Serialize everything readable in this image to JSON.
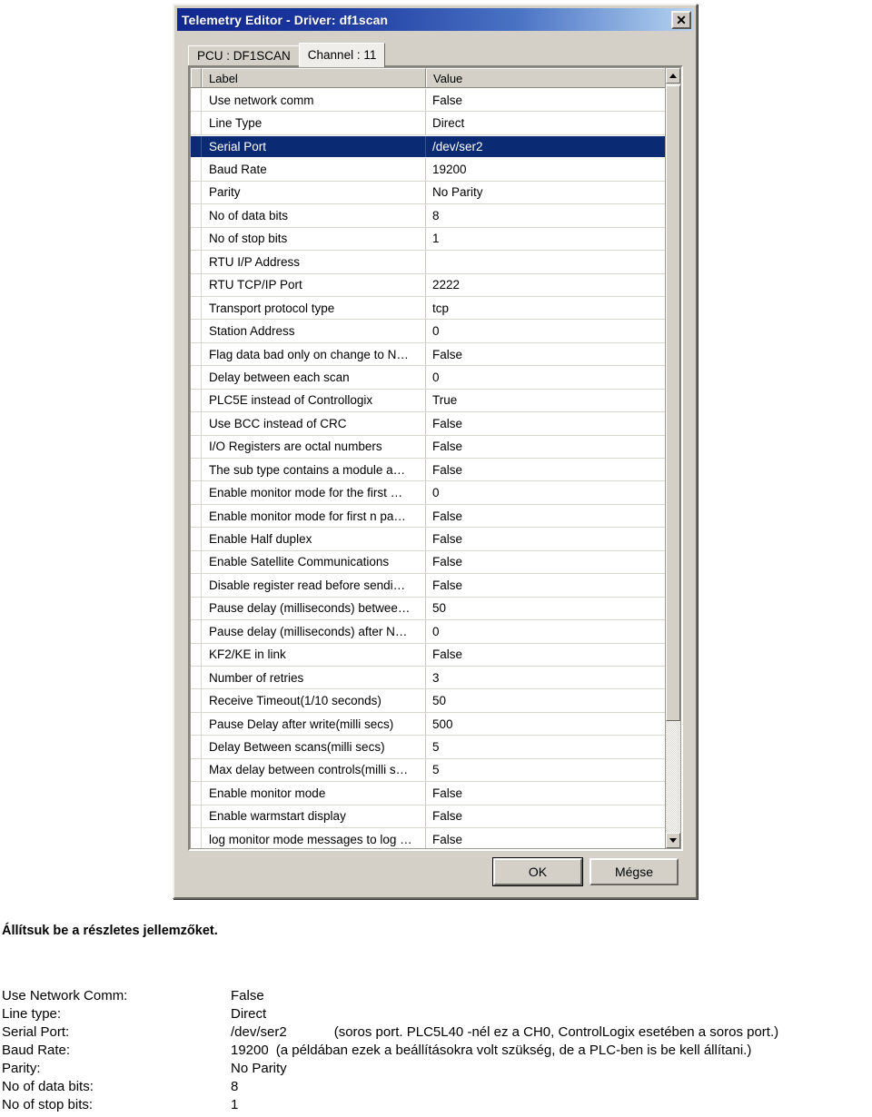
{
  "dialog": {
    "title": "Telemetry Editor - Driver: df1scan",
    "close_label": "✕",
    "tabs": [
      {
        "label": "PCU : DF1SCAN",
        "active": false
      },
      {
        "label": "Channel : 11",
        "active": true
      }
    ],
    "grid": {
      "columns": [
        "Label",
        "Value"
      ],
      "selected_index": 2,
      "rows": [
        {
          "label": "Use network comm",
          "value": "False"
        },
        {
          "label": "Line Type",
          "value": "Direct"
        },
        {
          "label": "Serial Port",
          "value": "/dev/ser2"
        },
        {
          "label": "Baud Rate",
          "value": "19200"
        },
        {
          "label": "Parity",
          "value": "No Parity"
        },
        {
          "label": "No of data bits",
          "value": "8"
        },
        {
          "label": "No of stop bits",
          "value": "1"
        },
        {
          "label": "RTU I/P Address",
          "value": ""
        },
        {
          "label": "RTU TCP/IP Port",
          "value": "2222"
        },
        {
          "label": "Transport protocol type",
          "value": "tcp"
        },
        {
          "label": "Station Address",
          "value": "0"
        },
        {
          "label": "Flag data bad only on change to N…",
          "value": "False"
        },
        {
          "label": "Delay between each scan",
          "value": "0"
        },
        {
          "label": "PLC5E instead of Controllogix",
          "value": "True"
        },
        {
          "label": "Use BCC instead of CRC",
          "value": "False"
        },
        {
          "label": "I/O Registers are octal numbers",
          "value": "False"
        },
        {
          "label": "The sub type contains a module a…",
          "value": "False"
        },
        {
          "label": "Enable monitor mode for the first …",
          "value": "0"
        },
        {
          "label": "Enable monitor mode for first n pa…",
          "value": "False"
        },
        {
          "label": "Enable Half duplex",
          "value": "False"
        },
        {
          "label": "Enable Satellite Communications",
          "value": "False"
        },
        {
          "label": "Disable register read before sendi…",
          "value": "False"
        },
        {
          "label": "Pause delay (milliseconds) betwee…",
          "value": "50"
        },
        {
          "label": "Pause delay (milliseconds) after N…",
          "value": "0"
        },
        {
          "label": "KF2/KE in link",
          "value": "False"
        },
        {
          "label": "Number of retries",
          "value": "3"
        },
        {
          "label": "Receive Timeout(1/10 seconds)",
          "value": "50"
        },
        {
          "label": "Pause Delay after write(milli secs)",
          "value": "500"
        },
        {
          "label": "Delay Between scans(milli secs)",
          "value": "5"
        },
        {
          "label": "Max delay between controls(milli s…",
          "value": "5"
        },
        {
          "label": "Enable monitor mode",
          "value": "False"
        },
        {
          "label": "Enable warmstart display",
          "value": "False"
        },
        {
          "label": "log monitor mode messages to log …",
          "value": "False"
        }
      ]
    },
    "buttons": {
      "ok": "OK",
      "cancel": "Mégse"
    },
    "scrollbar": {
      "up_icon": "triangle-up",
      "down_icon": "triangle-down"
    }
  },
  "document": {
    "heading": "Állítsuk be a részletes jellemzőket.",
    "specs": [
      {
        "key": "Use Network Comm:",
        "value": "False",
        "note": ""
      },
      {
        "key": "Line type:",
        "value": "Direct",
        "note": ""
      },
      {
        "key": "Serial Port:",
        "value": "/dev/ser2",
        "note": "(soros port. PLC5L40 -nél ez a CH0, ControlLogix esetében a soros port.)"
      },
      {
        "key": "Baud Rate:",
        "value": "19200",
        "note": "(a példában ezek a beállításokra volt szükség, de a PLC-ben is be kell állítani.)"
      },
      {
        "key": "Parity:",
        "value": "No Parity",
        "note": ""
      },
      {
        "key": "No of data bits:",
        "value": "8",
        "note": ""
      },
      {
        "key": "No of stop bits:",
        "value": "1",
        "note": ""
      }
    ]
  },
  "colors": {
    "titlebar_start": "#11288f",
    "titlebar_end": "#b9d2ef",
    "dialog_face": "#d4d0c8",
    "selection": "#0a2a73"
  }
}
